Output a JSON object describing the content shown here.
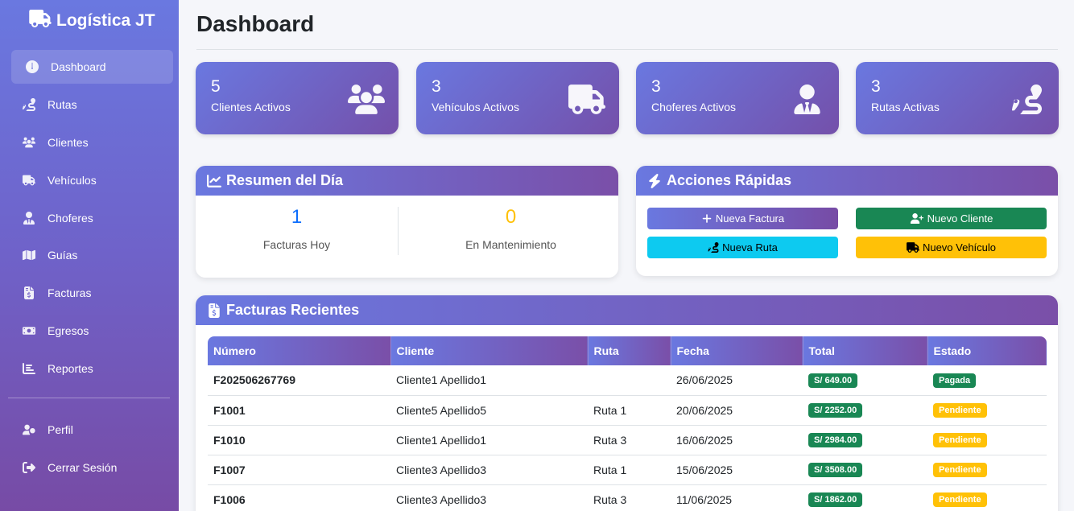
{
  "brand": {
    "name": "Logística JT"
  },
  "sidebar": {
    "items": [
      {
        "label": "Dashboard",
        "icon": "gauge-icon",
        "active": true
      },
      {
        "label": "Rutas",
        "icon": "route-icon"
      },
      {
        "label": "Clientes",
        "icon": "users-icon"
      },
      {
        "label": "Vehículos",
        "icon": "truck-icon"
      },
      {
        "label": "Choferes",
        "icon": "user-tie-icon"
      },
      {
        "label": "Guías",
        "icon": "map-icon"
      },
      {
        "label": "Facturas",
        "icon": "invoice-icon"
      },
      {
        "label": "Egresos",
        "icon": "money-icon"
      },
      {
        "label": "Reportes",
        "icon": "chart-icon"
      }
    ],
    "bottom_items": [
      {
        "label": "Perfil",
        "icon": "user-gear-icon"
      },
      {
        "label": "Cerrar Sesión",
        "icon": "logout-icon"
      }
    ]
  },
  "page": {
    "title": "Dashboard"
  },
  "stats": [
    {
      "value": "5",
      "label": "Clientes Activos",
      "icon": "users-icon"
    },
    {
      "value": "3",
      "label": "Vehículos Activos",
      "icon": "truck-icon"
    },
    {
      "value": "3",
      "label": "Choferes Activos",
      "icon": "user-tie-icon"
    },
    {
      "value": "3",
      "label": "Rutas Activas",
      "icon": "route-icon"
    }
  ],
  "summary": {
    "title": "Resumen del Día",
    "items": [
      {
        "value": "1",
        "caption": "Facturas Hoy",
        "color": "#0d6efd"
      },
      {
        "value": "0",
        "caption": "En Mantenimiento",
        "color": "#ffc107"
      }
    ]
  },
  "quick_actions": {
    "title": "Acciones Rápidas",
    "buttons": [
      {
        "label": "Nueva Factura",
        "icon": "plus-icon",
        "color": "#6f62c9"
      },
      {
        "label": "Nuevo Cliente",
        "icon": "user-plus-icon",
        "color": "#198754"
      },
      {
        "label": "Nueva Ruta",
        "icon": "route-icon",
        "color": "#0dcaf0"
      },
      {
        "label": "Nuevo Vehículo",
        "icon": "truck-icon",
        "color": "#ffc107"
      }
    ]
  },
  "invoices": {
    "title": "Facturas Recientes",
    "columns": [
      "Número",
      "Cliente",
      "Ruta",
      "Fecha",
      "Total",
      "Estado"
    ],
    "rows": [
      {
        "numero": "F202506267769",
        "cliente": "Cliente1 Apellido1",
        "ruta": "",
        "fecha": "26/06/2025",
        "total": "S/ 649.00",
        "estado": "Pagada"
      },
      {
        "numero": "F1001",
        "cliente": "Cliente5 Apellido5",
        "ruta": "Ruta 1",
        "fecha": "20/06/2025",
        "total": "S/ 2252.00",
        "estado": "Pendiente"
      },
      {
        "numero": "F1010",
        "cliente": "Cliente1 Apellido1",
        "ruta": "Ruta 3",
        "fecha": "16/06/2025",
        "total": "S/ 2984.00",
        "estado": "Pendiente"
      },
      {
        "numero": "F1007",
        "cliente": "Cliente3 Apellido3",
        "ruta": "Ruta 1",
        "fecha": "15/06/2025",
        "total": "S/ 3508.00",
        "estado": "Pendiente"
      },
      {
        "numero": "F1006",
        "cliente": "Cliente3 Apellido3",
        "ruta": "Ruta 3",
        "fecha": "11/06/2025",
        "total": "S/ 1862.00",
        "estado": "Pendiente"
      }
    ]
  }
}
